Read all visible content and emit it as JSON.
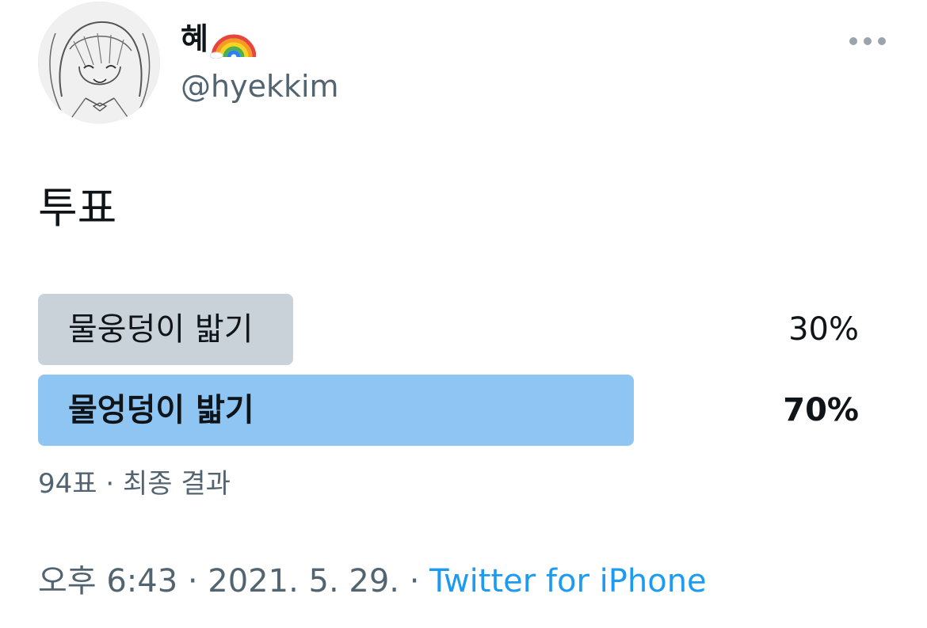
{
  "author": {
    "display_name": "혜",
    "emoji_icon": "rainbow-icon",
    "handle": "@hyekkim",
    "avatar_icon": "anime-girl-sketch-avatar"
  },
  "menu": {
    "more_icon": "more-horizontal-icon"
  },
  "tweet": {
    "text": "투표"
  },
  "poll": {
    "options": [
      {
        "label": "물웅덩이 밟기",
        "percent_text": "30%",
        "percent": 30,
        "leader": false,
        "color": "#c9d1d9"
      },
      {
        "label": "물엉덩이 밟기",
        "percent_text": "70%",
        "percent": 70,
        "leader": true,
        "color": "#8ec5f2"
      }
    ],
    "footer": "94표 · 최종 결과"
  },
  "meta": {
    "time_date": "오후 6:43 · 2021. 5. 29. · ",
    "source": "Twitter for iPhone"
  },
  "colors": {
    "text_primary": "#0f1419",
    "text_secondary": "#536471",
    "link": "#1d9bf0"
  }
}
